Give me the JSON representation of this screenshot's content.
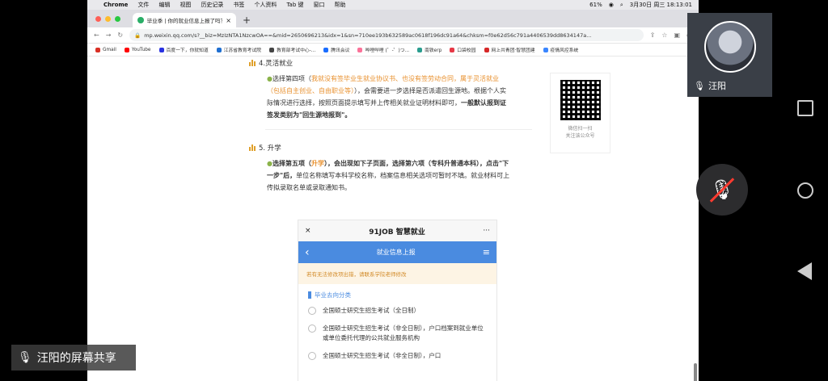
{
  "menubar": {
    "app": "Chrome",
    "items": [
      "文件",
      "编辑",
      "视图",
      "历史记录",
      "书签",
      "个人资料",
      "Tab 键",
      "窗口",
      "帮助"
    ],
    "battery": "61%",
    "datetime": "3月30日 周三  18:13:01"
  },
  "tab": {
    "title": "毕业季 | 你的就业信息上报了吗？",
    "close": "×",
    "new": "+"
  },
  "address": {
    "url": "mp.weixin.qq.com/s?__biz=MzIzNTA1NzcwOA==&mid=2650696213&idx=1&sn=710ee193b632589ac0618f196dc91a64&chksm=f0e62d56c791a4406539dd8634147a..."
  },
  "bookmarks": [
    {
      "label": "Gmail",
      "color": "#d93025"
    },
    {
      "label": "YouTube",
      "color": "#ff0000"
    },
    {
      "label": "百度一下，你就知道",
      "color": "#2932e1"
    },
    {
      "label": "江苏省教育考试院",
      "color": "#1f6fd1"
    },
    {
      "label": "教育部考试中心-...",
      "color": "#444444"
    },
    {
      "label": "腾讯会议",
      "color": "#1a6dff"
    },
    {
      "label": "哔哩哔哩 (゜-゜)つ...",
      "color": "#fb7299"
    },
    {
      "label": "南铁erp",
      "color": "#2a9d8f"
    },
    {
      "label": "口袋校园",
      "color": "#e63946"
    },
    {
      "label": "网上共青团·智慧团建",
      "color": "#d62828"
    },
    {
      "label": "疫情风控系统",
      "color": "#3a86ff"
    }
  ],
  "article": {
    "section4": "4.灵活就业",
    "para4": {
      "lead": "选择第四项（",
      "orange1": "我就没有签毕业生就业协议书、也没有签劳动合同，属于灵活就业（包括自主创业、自由职业等）",
      "mid": "），会需要进一步选择是否派遣回生源地。根据个人实际情况进行选择，按照页面提示填写并上传相关就业证明材料即可，",
      "bold": "一般默认报到证签发类别为\"回生源地报到\"。"
    },
    "section5": "5. 升学",
    "para5": {
      "lead": "选择第五项（",
      "orange": "升学",
      "bold": "），会出现如下子页面，选择第六项（专科升普通本科），点击\"下一步\"后，",
      "rest": "单位名称填写本科学校名称，档案信息相关选项可暂时不填。就业材料可上传拟录取名单或录取通知书。"
    }
  },
  "phone": {
    "app_title": "91JOB 智慧就业",
    "close": "×",
    "more": "···",
    "nav_title": "就业信息上报",
    "back": "‹",
    "menu": "≡",
    "warning": "若有无法修改项出错，请联系学院老师修改",
    "section": "毕业去向分类",
    "options": [
      "全国硕士研究生招生考试（全日制）",
      "全国硕士研究生招生考试（非全日制），户口档案到就业单位或单位委托代理的公共就业服务机构",
      "全国硕士研究生招生考试（非全日制），户口"
    ]
  },
  "qr": {
    "caption1": "微信扫一扫",
    "caption2": "关注该公众号"
  },
  "video": {
    "name": "汪阳"
  },
  "share": {
    "label": "汪阳的屏幕共享"
  }
}
